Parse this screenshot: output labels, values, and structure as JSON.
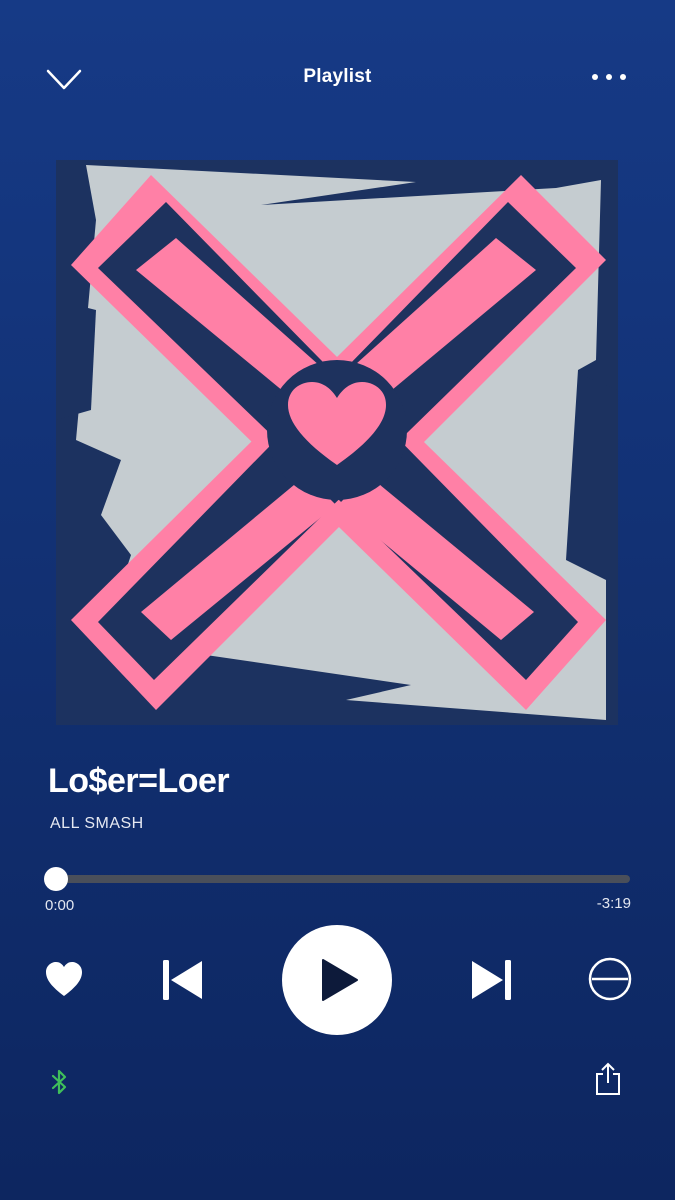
{
  "header": {
    "title": "Playlist",
    "collapse_icon": "chevron-down-icon",
    "more_icon": "more-dots-icon"
  },
  "artwork": {
    "colors": {
      "background": "#1c3260",
      "panel": "#c5ccd0",
      "pink": "#ff80a6",
      "navy": "#1e325e"
    }
  },
  "track": {
    "title": "Lo$er=Lo⁣er",
    "artist": "ALL SMASH"
  },
  "playback": {
    "elapsed": "0:00",
    "remaining": "-3:19",
    "progress": 0.0
  },
  "controls": {
    "like_icon": "heart-icon",
    "previous_icon": "skip-previous-icon",
    "play_icon": "play-icon",
    "next_icon": "skip-next-icon",
    "block_icon": "block-icon",
    "device_icon": "bluetooth-icon",
    "share_icon": "share-icon"
  },
  "colors": {
    "accent": "#ffffff",
    "bluetooth": "#3fbf5a",
    "track_bg": "#4a4f5a"
  }
}
